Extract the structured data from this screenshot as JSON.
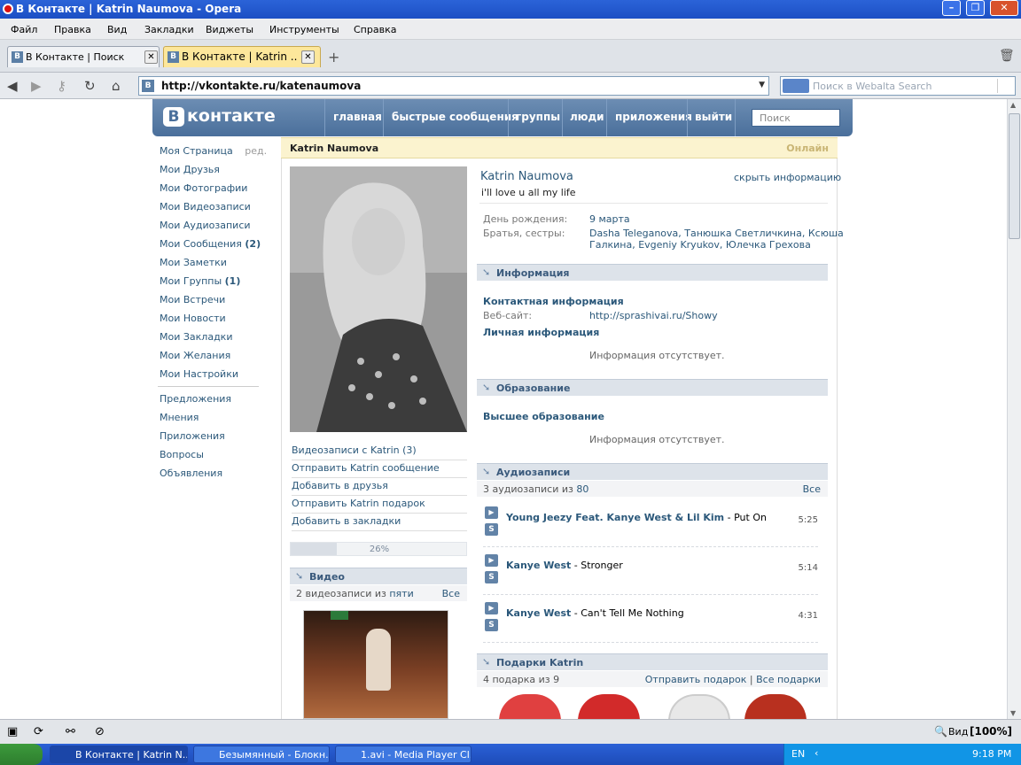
{
  "window": {
    "title": "В Контакте | Katrin Naumova - Opera"
  },
  "menu": [
    "Файл",
    "Правка",
    "Вид",
    "Закладки",
    "Виджеты",
    "Инструменты",
    "Справка"
  ],
  "tabs": [
    {
      "label": "В Контакте | Поиск",
      "fav": "B"
    },
    {
      "label": "В Контакте | Katrin ...",
      "fav": "B"
    }
  ],
  "address": {
    "url": "http://vkontakte.ru/katenaumova",
    "search_placeholder": "Поиск в Webalta Search"
  },
  "vk": {
    "logo": "контакте",
    "nav": [
      "главная",
      "быстрые сообщения",
      "группы",
      "люди",
      "приложения",
      "выйти"
    ],
    "search_placeholder": "Поиск"
  },
  "left_menu": [
    {
      "label": "Моя Страница",
      "extra": "ред."
    },
    {
      "label": "Мои Друзья"
    },
    {
      "label": "Мои Фотографии"
    },
    {
      "label": "Мои Видеозаписи"
    },
    {
      "label": "Мои Аудиозаписи"
    },
    {
      "label": "Мои Сообщения",
      "count": "(2)"
    },
    {
      "label": "Мои Заметки"
    },
    {
      "label": "Мои Группы",
      "count": "(1)"
    },
    {
      "label": "Мои Встречи"
    },
    {
      "label": "Мои Новости"
    },
    {
      "label": "Мои Закладки"
    },
    {
      "label": "Мои Желания"
    },
    {
      "label": "Мои Настройки"
    }
  ],
  "left_menu2": [
    "Предложения",
    "Мнения",
    "Приложения",
    "Вопросы",
    "Объявления"
  ],
  "profile": {
    "bar_name": "Katrin Naumova",
    "online": "Онлайн",
    "name": "Katrin Naumova",
    "hide": "скрыть информацию",
    "status": "i'll love u all my life",
    "bday_label": "День рождения:",
    "bday": "9 марта",
    "siblings_label": "Братья, сестры:",
    "siblings_line1": "Dasha Teleganova, Танюшка Светличкина, Ксюша",
    "siblings_line2": "Галкина, Evgeniy Kryukov, Юлечка Грехова"
  },
  "actions": [
    "Видеозаписи с Katrin (3)",
    "Отправить Katrin сообщение",
    "Добавить в друзья",
    "Отправить Katrin подарок",
    "Добавить в закладки"
  ],
  "progress": {
    "value": 26,
    "label": "26%"
  },
  "video": {
    "title": "Видео",
    "sub_pre": "2 видеозаписи из",
    "sub_link": "пяти",
    "all": "Все"
  },
  "info": {
    "title": "Информация",
    "contact": "Контактная информация",
    "site_label": "Веб-сайт:",
    "site": "http://sprashivai.ru/Showy",
    "personal": "Личная информация",
    "empty": "Информация отсутствует."
  },
  "education": {
    "title": "Образование",
    "higher": "Высшее образование",
    "empty": "Информация отсутствует."
  },
  "audio": {
    "title": "Аудиозаписи",
    "sub_pre": "3 аудиозаписи из",
    "sub_link": "80",
    "all": "Все",
    "tracks": [
      {
        "artist": "Young Jeezy Feat. Kanye West & Lil Kim",
        "title": " - Put On",
        "dur": "5:25"
      },
      {
        "artist": "Kanye West",
        "title": " - Stronger",
        "dur": "5:14"
      },
      {
        "artist": "Kanye West",
        "title": " - Can't Tell Me Nothing",
        "dur": "4:31"
      }
    ]
  },
  "gifts": {
    "title": "Подарки Katrin",
    "sub": "4 подарка из 9",
    "send": "Отправить подарок",
    "sep": "|",
    "all": "Все подарки"
  },
  "statusbar": {
    "zoom_label": "Вид",
    "zoom": "[100%]"
  },
  "taskbar": {
    "items": [
      "В Контакте | Katrin N...",
      "Безымянный - Блокн...",
      "1.avi - Media Player Cl..."
    ],
    "lang": "EN",
    "time": "9:18 PM"
  },
  "colors": {
    "vk_blue": "#4a6f9b",
    "link": "#2b587a",
    "online": "#c9b574"
  }
}
